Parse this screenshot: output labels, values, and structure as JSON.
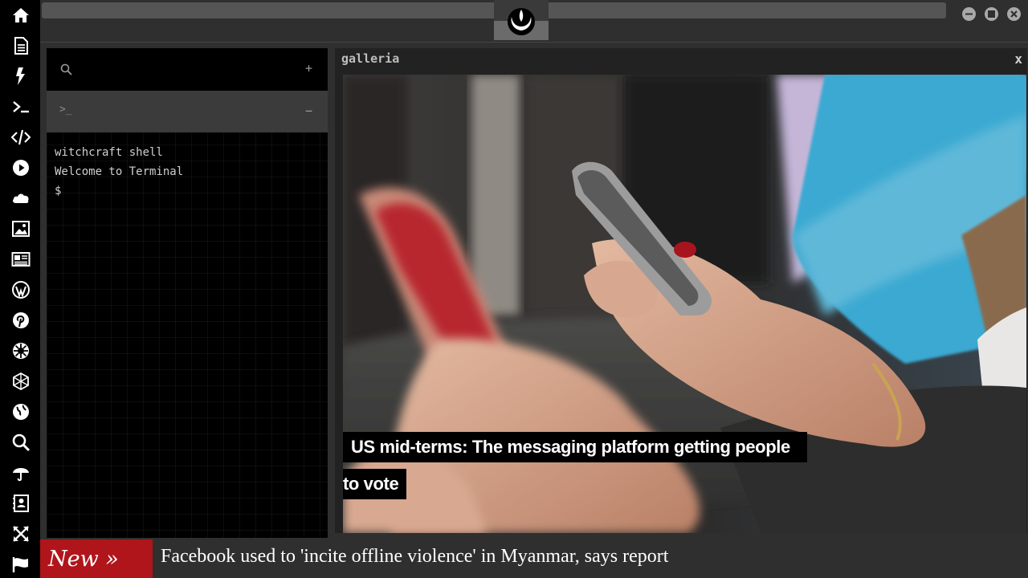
{
  "dock": {
    "items": [
      {
        "icon": "home-icon"
      },
      {
        "icon": "document-icon"
      },
      {
        "icon": "lightning-icon"
      },
      {
        "icon": "terminal-icon"
      },
      {
        "icon": "code-icon"
      },
      {
        "icon": "play-icon"
      },
      {
        "icon": "cloud-icon"
      },
      {
        "icon": "image-icon"
      },
      {
        "icon": "newspaper-icon"
      },
      {
        "icon": "wordpress-icon"
      },
      {
        "icon": "pinterest-icon"
      },
      {
        "icon": "galactic-empire-icon"
      },
      {
        "icon": "network-icon"
      },
      {
        "icon": "globe-icon"
      },
      {
        "icon": "search-icon"
      },
      {
        "icon": "umbrella-icon"
      },
      {
        "icon": "contact-book-icon"
      },
      {
        "icon": "expand-icon"
      },
      {
        "icon": "flag-icon"
      }
    ]
  },
  "window_controls": [
    "minimize-icon",
    "maximize-icon",
    "close-icon"
  ],
  "logo": {
    "icon": "rebel-alliance-icon"
  },
  "terminal": {
    "search_icon": "search-icon",
    "add_label": "+",
    "prompt_icon": ">_",
    "collapse_label": "−",
    "output": [
      "witchcraft shell",
      "Welcome to Terminal",
      "$"
    ]
  },
  "gallery": {
    "title": "galleria",
    "close_label": "x",
    "caption": {
      "line1": "US mid-terms: The messaging platform getting people",
      "line2": "to vote"
    }
  },
  "ticker": {
    "badge": "New »",
    "headline": "Facebook used to 'incite offline violence' in Myanmar, says report"
  },
  "colors": {
    "dock_bg": "#000000",
    "panel_bg": "#2f2f2f",
    "ticker_badge": "#b0151b",
    "icon_fg": "#ffffff"
  }
}
